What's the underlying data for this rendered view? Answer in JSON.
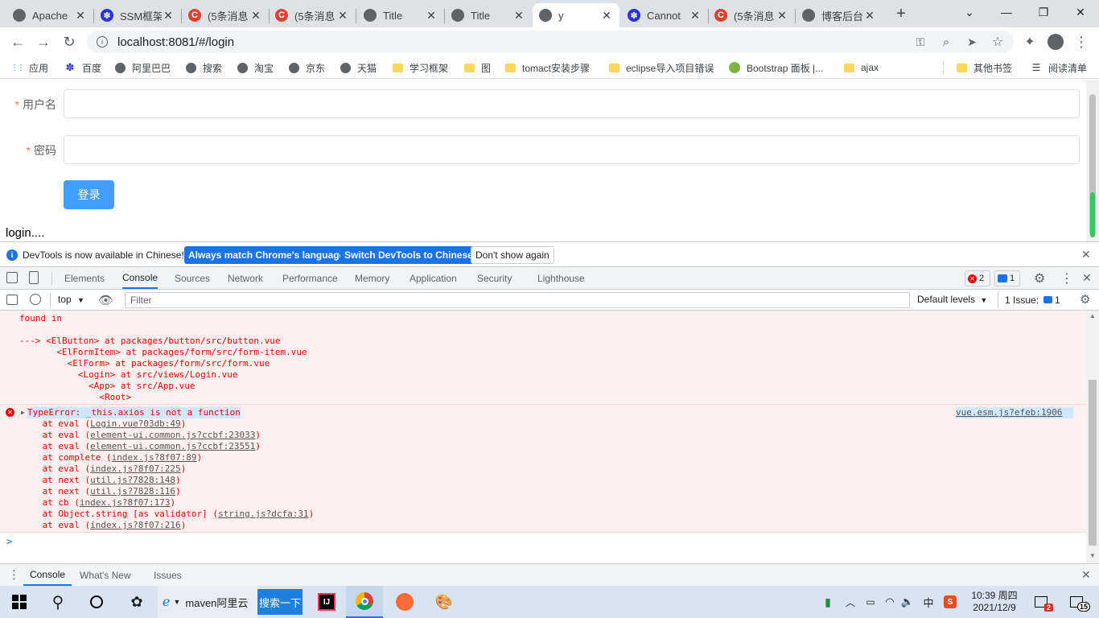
{
  "tabs": [
    {
      "title": "Apache",
      "icon": "globe-icon",
      "color": "#5f6368"
    },
    {
      "title": "SSM框架",
      "icon": "baidu-icon",
      "color": "#2932e1"
    },
    {
      "title": "(5条消息",
      "icon": "csdn-icon",
      "color": "#e33e33"
    },
    {
      "title": "(5条消息",
      "icon": "csdn-icon",
      "color": "#e33e33"
    },
    {
      "title": "Title",
      "icon": "globe-icon",
      "color": "#5f6368"
    },
    {
      "title": "Title",
      "icon": "globe-icon",
      "color": "#5f6368"
    },
    {
      "title": "y",
      "icon": "globe-icon",
      "color": "#5f6368"
    },
    {
      "title": "Cannot",
      "icon": "baidu-icon",
      "color": "#2932e1"
    },
    {
      "title": "(5条消息",
      "icon": "csdn-icon",
      "color": "#e33e33"
    },
    {
      "title": "博客后台",
      "icon": "blog-icon",
      "color": "#5f6368"
    }
  ],
  "address": {
    "url": "localhost:8081/#/login"
  },
  "bookmarks": [
    {
      "label": "应用",
      "icon": "apps-grid-icon"
    },
    {
      "label": "百度",
      "icon": "baidu-icon"
    },
    {
      "label": "阿里巴巴",
      "icon": "globe-icon"
    },
    {
      "label": "搜索",
      "icon": "globe-icon"
    },
    {
      "label": "淘宝",
      "icon": "globe-icon"
    },
    {
      "label": "京东",
      "icon": "globe-icon"
    },
    {
      "label": "天猫",
      "icon": "globe-icon"
    },
    {
      "label": "学习框架",
      "icon": "folder-icon"
    },
    {
      "label": "图",
      "icon": "folder-icon"
    },
    {
      "label": "tomact安装步骤",
      "icon": "folder-icon"
    },
    {
      "label": "eclipse导入项目错误",
      "icon": "folder-icon"
    },
    {
      "label": "Bootstrap 面板 |...",
      "icon": "bootstrap-icon"
    },
    {
      "label": "ajax",
      "icon": "folder-icon"
    },
    {
      "label": "其他书签",
      "icon": "folder-icon"
    },
    {
      "label": "阅读清单",
      "icon": "reading-list-icon"
    }
  ],
  "form": {
    "username_label": "用户名",
    "password_label": "密码",
    "required_mark": "*",
    "login_button": "登录",
    "status_text": "login...."
  },
  "infobar": {
    "message": "DevTools is now available in Chinese!",
    "btn_match": "Always match Chrome's language",
    "btn_switch": "Switch DevTools to Chinese",
    "btn_dismiss": "Don't show again"
  },
  "devtools": {
    "tabs": [
      "Elements",
      "Console",
      "Sources",
      "Network",
      "Performance",
      "Memory",
      "Application",
      "Security",
      "Lighthouse"
    ],
    "active_tab": "Console",
    "error_count": "2",
    "message_count": "1",
    "context": "top",
    "filter_placeholder": "Filter",
    "levels": "Default levels",
    "issues_label": "1 Issue:",
    "issues_count": "1"
  },
  "console": {
    "found_in": "found in",
    "component_trace": [
      "---> <ElButton> at packages/button/src/button.vue",
      "       <ElFormItem> at packages/form/src/form-item.vue",
      "         <ElForm> at packages/form/src/form.vue",
      "           <Login> at src/views/Login.vue",
      "             <App> at src/App.vue",
      "               <Root>"
    ],
    "error_message": "TypeError: _this.axios is not a function",
    "error_source": "vue.esm.js?efeb:1906",
    "stack": [
      {
        "prefix": "    at eval (",
        "link": "Login.vue?03db:49",
        "suffix": ")"
      },
      {
        "prefix": "    at eval (",
        "link": "element-ui.common.js?ccbf:23033",
        "suffix": ")"
      },
      {
        "prefix": "    at eval (",
        "link": "element-ui.common.js?ccbf:23551",
        "suffix": ")"
      },
      {
        "prefix": "    at complete (",
        "link": "index.js?8f07:89",
        "suffix": ")"
      },
      {
        "prefix": "    at eval (",
        "link": "index.js?8f07:225",
        "suffix": ")"
      },
      {
        "prefix": "    at next (",
        "link": "util.js?7828:148",
        "suffix": ")"
      },
      {
        "prefix": "    at next (",
        "link": "util.js?7828:116",
        "suffix": ")"
      },
      {
        "prefix": "    at cb (",
        "link": "index.js?8f07:173",
        "suffix": ")"
      },
      {
        "prefix": "    at Object.string [as validator] (",
        "link": "string.js?dcfa:31",
        "suffix": ")"
      },
      {
        "prefix": "    at eval (",
        "link": "index.js?8f07:216",
        "suffix": ")"
      }
    ],
    "prompt": ">"
  },
  "drawer": {
    "tabs": [
      "Console",
      "What's New",
      "Issues"
    ]
  },
  "taskbar": {
    "search_text": "maven阿里云",
    "search_button": "搜索一下",
    "time": "10:39 周四",
    "date": "2021/12/9",
    "ime": "中",
    "notif_badge": "2",
    "action_badge": "15"
  },
  "colors": {
    "accent": "#1a73e8",
    "primary_button": "#409eff",
    "error": "#e00000",
    "required": "#f56c6c"
  }
}
